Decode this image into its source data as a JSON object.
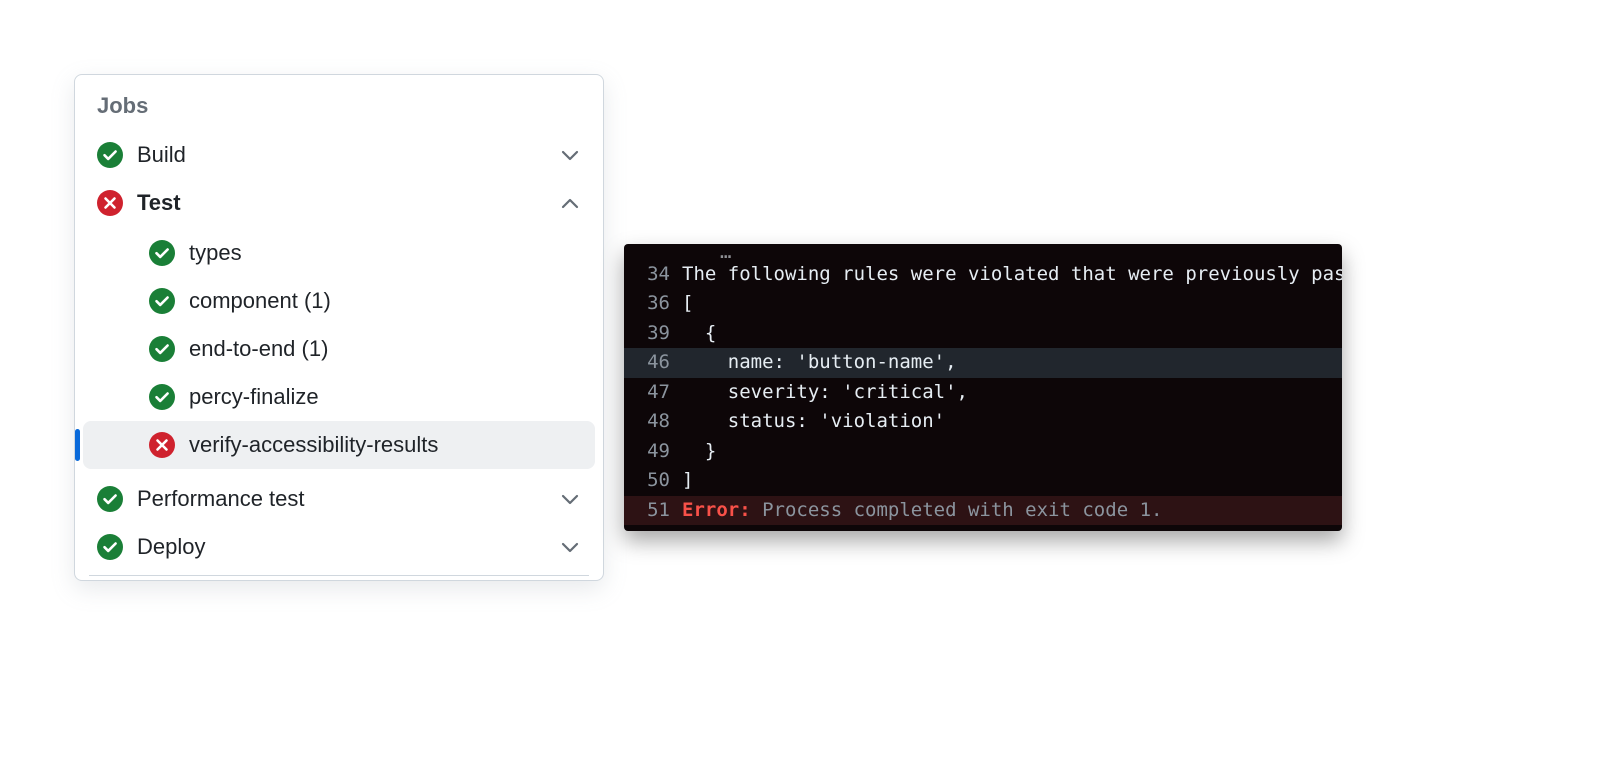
{
  "jobs": {
    "title": "Jobs",
    "items": [
      {
        "label": "Build",
        "status": "success",
        "expanded": false
      },
      {
        "label": "Test",
        "status": "failure",
        "expanded": true,
        "children": [
          {
            "label": "types",
            "status": "success",
            "selected": false
          },
          {
            "label": "component (1)",
            "status": "success",
            "selected": false
          },
          {
            "label": "end-to-end (1)",
            "status": "success",
            "selected": false
          },
          {
            "label": "percy-finalize",
            "status": "success",
            "selected": false
          },
          {
            "label": "verify-accessibility-results",
            "status": "failure",
            "selected": true
          }
        ]
      },
      {
        "label": "Performance test",
        "status": "success",
        "expanded": false
      },
      {
        "label": "Deploy",
        "status": "success",
        "expanded": false
      }
    ]
  },
  "log": {
    "lines": [
      {
        "n": "34",
        "text": "The following rules were violated that were previously passing:"
      },
      {
        "n": "36",
        "text": "["
      },
      {
        "n": "39",
        "text": "  {"
      },
      {
        "n": "46",
        "text": "    name: 'button-name',",
        "highlight": true
      },
      {
        "n": "47",
        "text": "    severity: 'critical',"
      },
      {
        "n": "48",
        "text": "    status: 'violation'"
      },
      {
        "n": "49",
        "text": "  }"
      },
      {
        "n": "50",
        "text": "]"
      },
      {
        "n": "51",
        "error_prefix": "Error:",
        "text": " Process completed with exit code 1.",
        "error": true
      }
    ]
  }
}
